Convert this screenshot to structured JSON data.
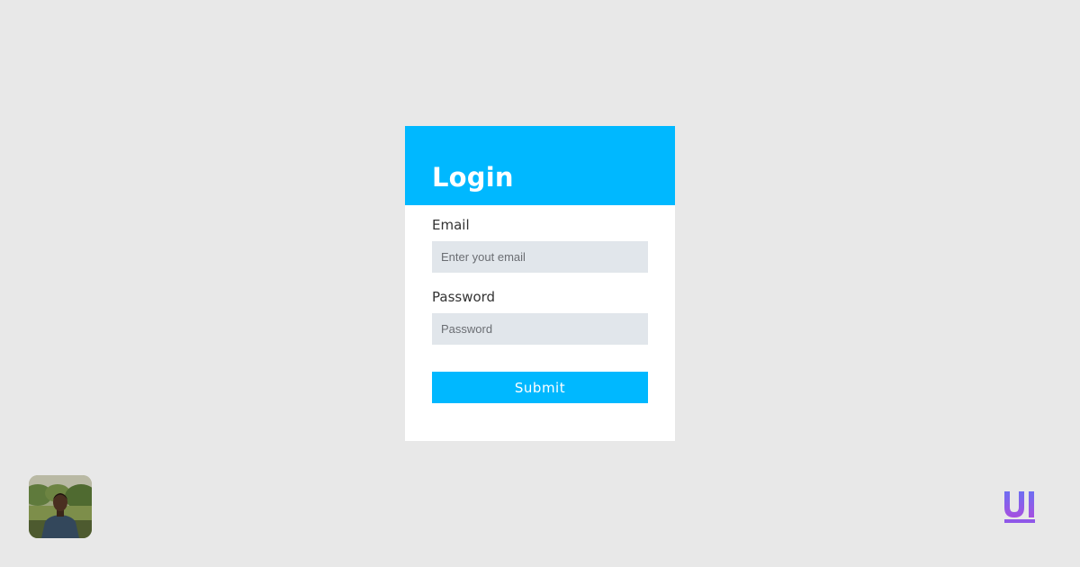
{
  "login_form": {
    "title": "Login",
    "email_label": "Email",
    "email_placeholder": "Enter yout email",
    "email_value": "",
    "password_label": "Password",
    "password_placeholder": "Password",
    "password_value": "",
    "submit_label": "Submit"
  },
  "icons": {
    "avatar": "user-avatar-photo",
    "brand_logo": "ui-logo-icon"
  },
  "colors": {
    "page_background": "#e8e8e8",
    "accent": "#00b8ff",
    "card_background": "#ffffff",
    "input_background": "#e1e6eb",
    "logo_gradient_start": "#6e6ef2",
    "logo_gradient_end": "#a64fe0"
  }
}
